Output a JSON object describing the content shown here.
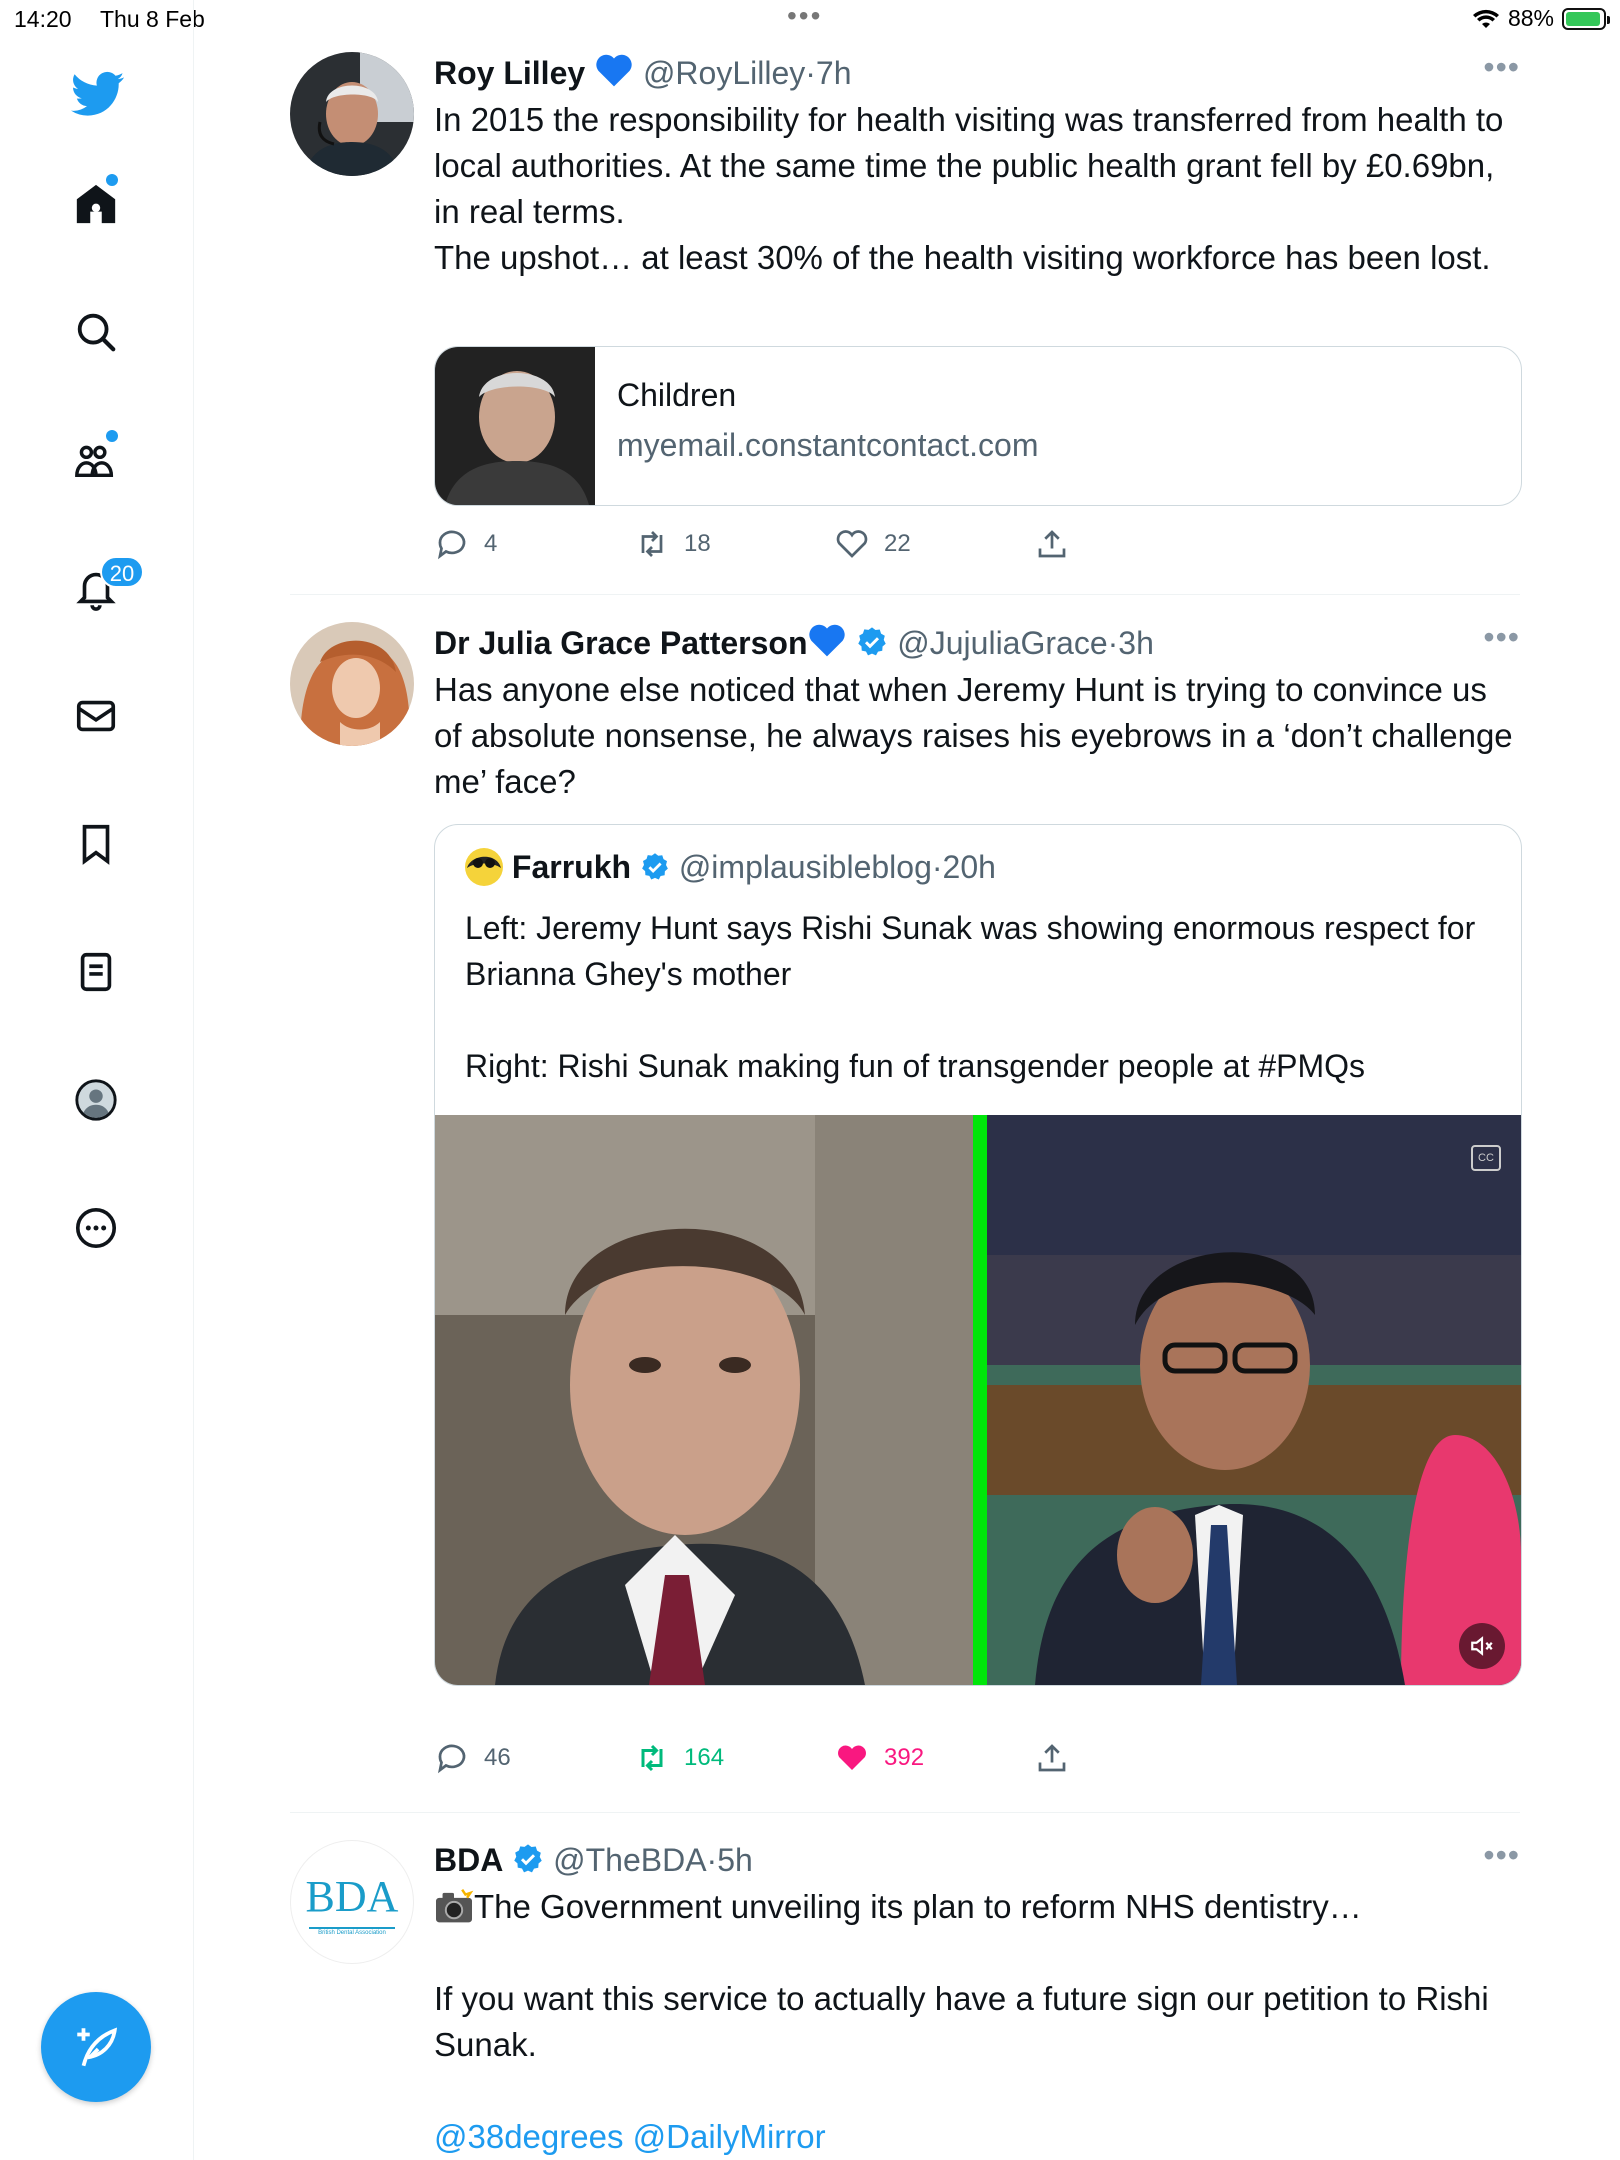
{
  "status_bar": {
    "time": "14:20",
    "date": "Thu 8 Feb",
    "battery": "88%"
  },
  "sidebar": {
    "notifications_badge": "20"
  },
  "tweets": [
    {
      "name": "Roy Lilley",
      "handle": "@RoyLilley",
      "time": "7h",
      "text": "In 2015 the responsibility for health visiting was transferred from health to local authorities. At the same time the public health grant fell by £0.69bn, in real terms.\nThe upshot… at least 30% of the health visiting workforce has been lost.",
      "card": {
        "title": "Children",
        "domain": "myemail.constantcontact.com"
      },
      "replies": "4",
      "retweets": "18",
      "likes": "22"
    },
    {
      "name": "Dr Julia Grace Patterson",
      "handle": "@JujuliaGrace",
      "time": "3h",
      "text": "Has anyone else noticed that when Jeremy Hunt is trying to convince us of absolute nonsense, he always raises his eyebrows in a ‘don’t challenge me’ face?",
      "quote": {
        "name": "Farrukh",
        "handle": "@implausibleblog",
        "time": "20h",
        "text": "Left: Jeremy Hunt says Rishi Sunak was showing enormous respect for Brianna Ghey's mother\n\nRight: Rishi Sunak making fun of transgender people at #PMQs"
      },
      "replies": "46",
      "retweets": "164",
      "likes": "392"
    },
    {
      "name": "BDA",
      "handle": "@TheBDA",
      "time": "5h",
      "avatar_text": "BDA",
      "avatar_subtext": "British Dental Association",
      "text_line1": "The Government unveiling its plan to reform NHS dentistry…",
      "text_line2": "If you want this service to actually have a future sign our petition to Rishi Sunak.",
      "mentions": "@38degrees @DailyMirror"
    }
  ],
  "colors": {
    "accent": "#1d9bf0",
    "retweet_green": "#00ba7c",
    "like_pink": "#f91880",
    "text_secondary": "#536471"
  }
}
